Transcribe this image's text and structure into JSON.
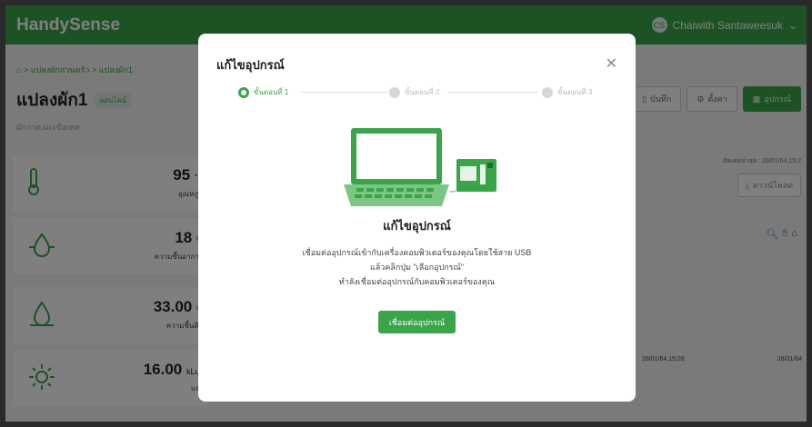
{
  "app": {
    "brand": "HandySense",
    "user_initials": "CS",
    "user_name": "Chaiwith Santaweesuk"
  },
  "breadcrumb": {
    "home_icon": "home-icon",
    "part1": "แปลงผักสวนครัว",
    "part2": "แปลงผัก1"
  },
  "page": {
    "title": "แปลงผัก1",
    "badge": "ออนไลน์",
    "subtitle": "ผักกาด,มะเขือเทศ"
  },
  "actions": {
    "save_label": "บันทึก",
    "settings_label": "ตั้งค่า",
    "device_label": "อุปกรณ์"
  },
  "cards": [
    {
      "icon": "thermometer-icon",
      "value": "95",
      "unit": "°C",
      "label": "อุณหภูมิ"
    },
    {
      "icon": "humidity-icon",
      "value": "18",
      "unit": "%",
      "label": "ความชื้นอากาศ"
    },
    {
      "icon": "soil-moisture-icon",
      "value": "33.00",
      "unit": "%",
      "label": "ความชื้นดิน"
    },
    {
      "icon": "sun-icon",
      "value": "16.00",
      "unit": "kLux",
      "label": "แสง"
    }
  ],
  "right": {
    "timestamp": "อัพเดทล่าสุด : 28/01/64,15:2",
    "download_label": "ดาวน์โหลด",
    "date_start": "28/01/64,15:26",
    "date_end": "28/01/64"
  },
  "modal": {
    "title": "แก้ไขอุปกรณ์",
    "steps": [
      "ขั้นตอนที่ 1",
      "ขั้นตอนที่ 2",
      "ขั้นตอนที่ 3"
    ],
    "heading": "แก้ไขอุปกรณ์",
    "desc_line1": "เชื่อมต่ออุปกรณ์เข้ากับเครื่องคอมพิวเตอร์ของคุณโดยใช้สาย USB",
    "desc_line2": "แล้วคลิกปุ่ม \"เลือกอุปกรณ์\"",
    "desc_line3": "ทำลังเชื่อมต่ออุปกรณ์กับคอมพิวเตอร์ของคุณ",
    "connect_label": "เชื่อมต่ออุปกรณ์"
  },
  "colors": {
    "accent": "#3aa548",
    "overlay": "rgba(0,0,0,0.5)"
  }
}
